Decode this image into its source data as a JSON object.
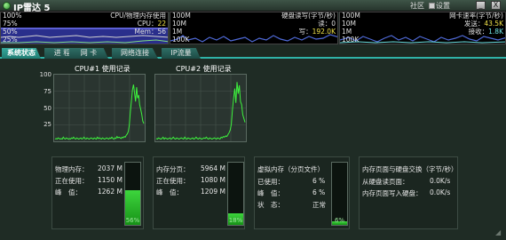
{
  "app": {
    "title": "IP雷达 5",
    "community": "社区",
    "settings": "设置",
    "minimize": "_",
    "close": "X"
  },
  "mini_cpu": {
    "top_left": "100%",
    "mid_left": "75%",
    "mid2_left": "50%",
    "bot_left": "25%",
    "title": "CPU/物理内存使用",
    "cpu_label": "CPU：",
    "cpu_value": "22",
    "mem_label": "Mem：",
    "mem_value": "56"
  },
  "mini_disk": {
    "l1": "100M",
    "l2": "10M",
    "l3": "1M",
    "l4": "100K",
    "title": "硬盘读写(字节/秒)",
    "read_label": "读：",
    "read_value": "0",
    "write_label": "写：",
    "write_value": "192.0K"
  },
  "mini_net": {
    "l1": "100M",
    "l2": "10M",
    "l3": "1M",
    "l4": "100K",
    "title": "网卡速率(字节/秒)",
    "send_label": "发送：",
    "send_value": "43.5K",
    "recv_label": "接收：",
    "recv_value": "1.8K"
  },
  "tabs": [
    "系统状态",
    "进 程",
    "网 卡",
    "网络连接",
    "IP流量"
  ],
  "cpu1": {
    "title": "CPU#1 使用记录",
    "ticks": [
      "100",
      "75",
      "50",
      "25"
    ],
    "values": [
      2,
      3,
      2,
      4,
      3,
      2,
      3,
      2,
      5,
      3,
      2,
      4,
      3,
      2,
      3,
      2,
      4,
      3,
      5,
      3,
      2,
      4,
      3,
      2,
      3,
      4,
      2,
      3,
      5,
      3,
      2,
      4,
      3,
      2,
      3,
      4,
      3,
      2,
      4,
      3,
      2,
      5,
      3,
      4,
      3,
      2,
      4,
      3,
      2,
      3,
      4,
      3,
      2,
      4,
      3,
      5,
      3,
      2,
      4,
      3,
      6,
      4,
      5,
      4,
      3,
      5,
      4,
      6,
      5,
      8,
      10,
      14,
      24,
      45,
      60,
      78,
      86,
      74,
      60,
      82,
      65,
      70,
      55,
      48,
      40,
      30,
      26
    ]
  },
  "cpu2": {
    "title": "CPU#2 使用记录",
    "ticks": [
      "100",
      "75",
      "50",
      "25"
    ],
    "values": [
      3,
      2,
      4,
      3,
      2,
      3,
      5,
      2,
      4,
      3,
      2,
      3,
      4,
      2,
      3,
      5,
      3,
      2,
      4,
      3,
      2,
      3,
      4,
      3,
      2,
      5,
      3,
      2,
      4,
      3,
      2,
      3,
      4,
      2,
      3,
      5,
      3,
      2,
      4,
      3,
      2,
      3,
      4,
      3,
      5,
      3,
      2,
      4,
      3,
      2,
      3,
      4,
      3,
      2,
      4,
      3,
      2,
      5,
      4,
      6,
      5,
      7,
      6,
      9,
      12,
      16,
      25,
      48,
      66,
      80,
      58,
      90,
      72,
      85,
      60,
      55,
      40,
      34,
      28
    ]
  },
  "phys": {
    "total_label": "物理内存：",
    "total_value": "2037 M",
    "used_label": "正在使用：",
    "used_value": "1150 M",
    "peak_label": "峰　值：",
    "peak_value": "1262 M",
    "percent": "56%",
    "fill": 0.56
  },
  "paging": {
    "total_label": "内存分页：",
    "total_value": "5964 M",
    "used_label": "正在使用：",
    "used_value": "1080 M",
    "peak_label": "峰　值：",
    "peak_value": "1209 M",
    "percent": "18%",
    "fill": 0.18
  },
  "virtual": {
    "title": "虚拟内存（分页文件）",
    "used_label": "已使用：",
    "used_value": "6 %",
    "peak_label": "峰　值：",
    "peak_value": "6 %",
    "state_label": "状　态：",
    "state_value": "正常",
    "percent": "6%",
    "fill": 0.06
  },
  "swap": {
    "title": "内存页面与硬盘交换（字节/秒）",
    "read_label": "从硬盘读页面：",
    "read_value": "0.0K/s",
    "write_label": "内存页面写入硬盘：",
    "write_value": "0.0K/s"
  },
  "colors": {
    "accent": "#2fb3a8",
    "graph_green": "#3df23d",
    "panel_bg": "#1f2c25"
  }
}
